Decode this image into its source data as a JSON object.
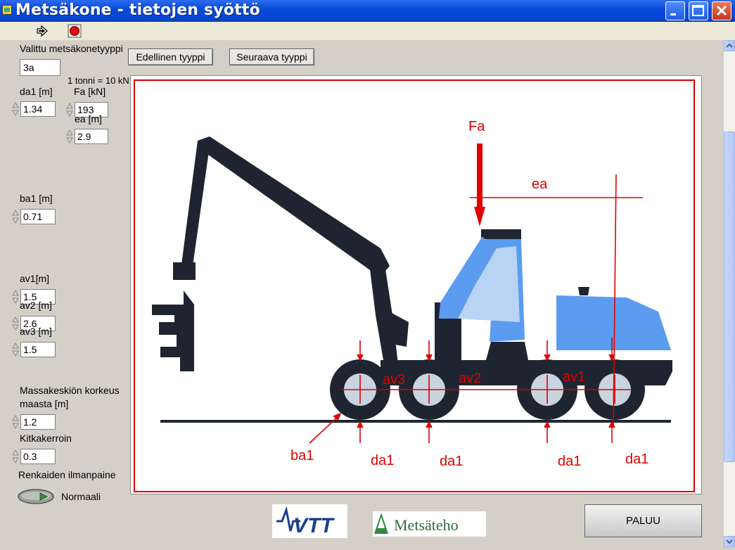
{
  "window": {
    "title": "Metsäkone - tietojen syöttö"
  },
  "toolbar": {
    "run_icon": "run-arrow-icon",
    "stop_icon": "stop-icon"
  },
  "fields": {
    "machine_type_label": "Valittu metsäkonetyyppi",
    "machine_type_value": "3a",
    "prev_button": "Edellinen tyyppi",
    "next_button": "Seuraava tyyppi",
    "ton_note": "1 tonni = 10 kN",
    "da1_label": "da1 [m]",
    "da1_value": "1.34",
    "fa_label": "Fa [kN]",
    "fa_value": "193",
    "ea_label": "ea [m]",
    "ea_value": "2.9",
    "ba1_label": "ba1 [m]",
    "ba1_value": "0.71",
    "av1_label": "av1[m]",
    "av1_value": "1.5",
    "av2_label": "av2 [m]",
    "av2_value": "2.6",
    "av3_label": "av3 [m]",
    "av3_value": "1.5",
    "cg_label_line1": "Massakeskiön korkeus",
    "cg_label_line2": "maasta [m]",
    "cg_value": "1.2",
    "friction_label": "Kitkakerroin",
    "friction_value": "0.3",
    "tyre_label": "Renkaiden ilmanpaine",
    "tyre_value": "Normaali"
  },
  "diagram": {
    "fa": "Fa",
    "ea": "ea",
    "av1": "av1",
    "av2": "av2",
    "av3": "av3",
    "ba1": "ba1",
    "da1": "da1",
    "colors": {
      "annotation": "#e00000",
      "machine": "#1e2530",
      "cab": "#5b9cf0",
      "glass": "#b9d3f5",
      "wheel": "#c8d4e0"
    }
  },
  "footer": {
    "vtt_logo": "VTT",
    "metsateho_logo": "Metsäteho",
    "back_button": "PALUU"
  }
}
